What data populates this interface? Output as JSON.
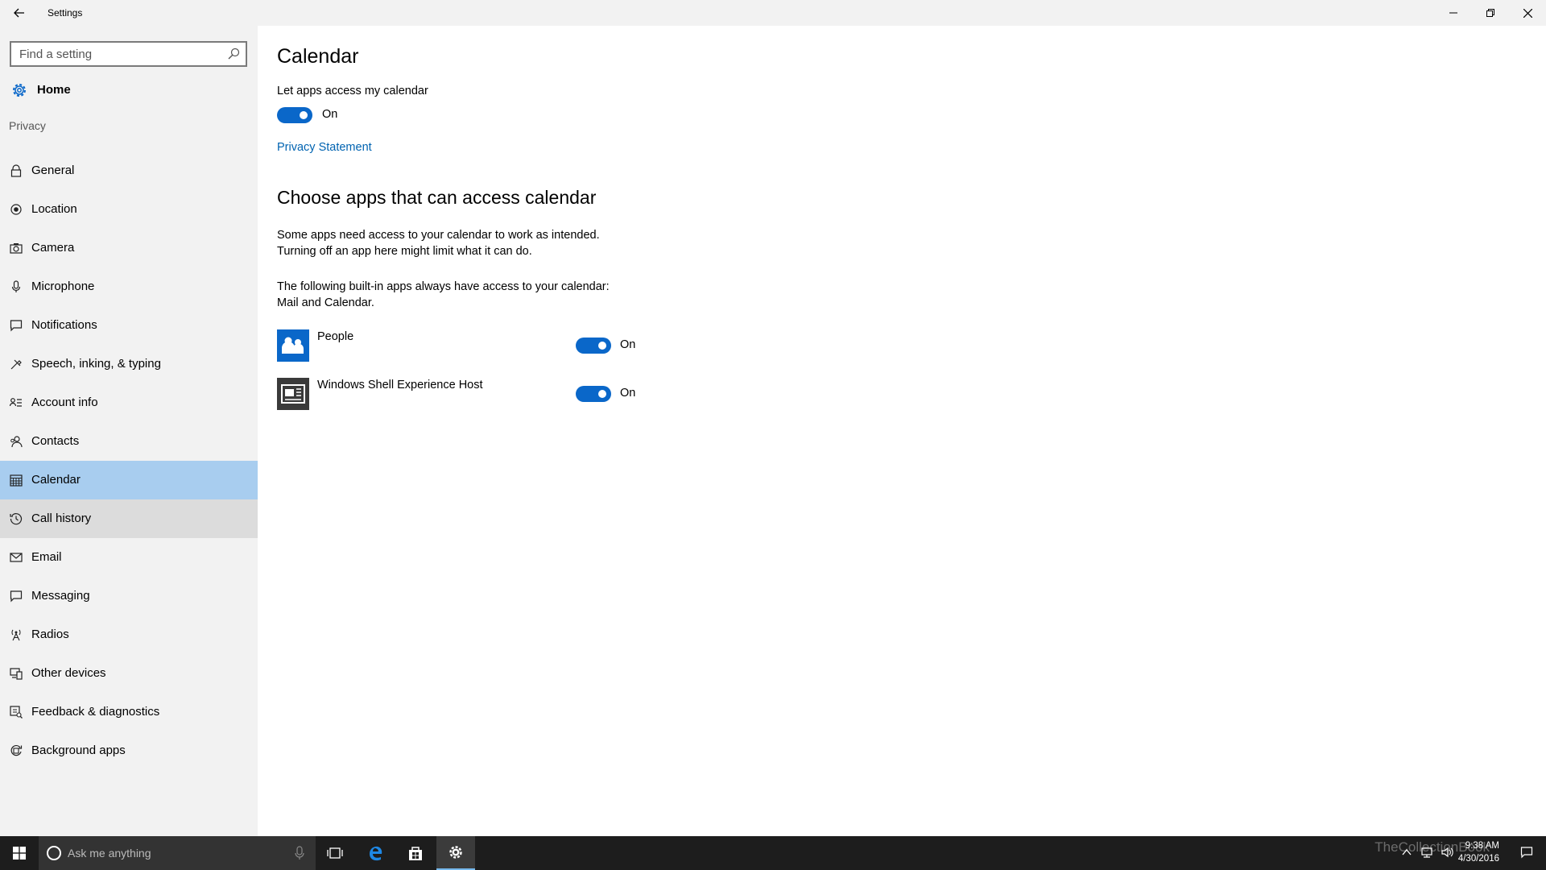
{
  "window": {
    "title": "Settings",
    "controls": {
      "minimize": "—",
      "restore": "❐",
      "close": "✕"
    }
  },
  "sidebar": {
    "search_placeholder": "Find a setting",
    "home_label": "Home",
    "section_label": "Privacy",
    "items": [
      {
        "label": "General",
        "icon": "lock-icon"
      },
      {
        "label": "Location",
        "icon": "location-icon"
      },
      {
        "label": "Camera",
        "icon": "camera-icon"
      },
      {
        "label": "Microphone",
        "icon": "microphone-icon"
      },
      {
        "label": "Notifications",
        "icon": "notifications-icon"
      },
      {
        "label": "Speech, inking, & typing",
        "icon": "speech-icon"
      },
      {
        "label": "Account info",
        "icon": "account-info-icon"
      },
      {
        "label": "Contacts",
        "icon": "contacts-icon"
      },
      {
        "label": "Calendar",
        "icon": "calendar-icon",
        "selected": true
      },
      {
        "label": "Call history",
        "icon": "call-history-icon",
        "hover": true
      },
      {
        "label": "Email",
        "icon": "email-icon"
      },
      {
        "label": "Messaging",
        "icon": "messaging-icon"
      },
      {
        "label": "Radios",
        "icon": "radios-icon"
      },
      {
        "label": "Other devices",
        "icon": "other-devices-icon"
      },
      {
        "label": "Feedback & diagnostics",
        "icon": "feedback-icon"
      },
      {
        "label": "Background apps",
        "icon": "background-apps-icon"
      }
    ]
  },
  "main": {
    "title": "Calendar",
    "access_label": "Let apps access my calendar",
    "access_toggle_state": "On",
    "privacy_link": "Privacy Statement",
    "choose_title": "Choose apps that can access calendar",
    "para1_line1": "Some apps need access to your calendar to work as intended.",
    "para1_line2": "Turning off an app here might limit what it can do.",
    "para2_line1": "The following built-in apps always have access to your calendar:",
    "para2_line2": "Mail and Calendar.",
    "apps": [
      {
        "name": "People",
        "state": "On",
        "icon": "people-app-icon"
      },
      {
        "name": "Windows Shell Experience Host",
        "state": "On",
        "icon": "shell-host-app-icon"
      }
    ]
  },
  "taskbar": {
    "search_text": "Ask me anything",
    "time": "9:38 AM",
    "date": "4/30/2016",
    "watermark": "TheCollectionBook"
  },
  "colors": {
    "accent": "#0a67c9",
    "selected_nav": "#a8cdef",
    "link": "#0063b1",
    "taskbar": "#1d1d1d"
  }
}
